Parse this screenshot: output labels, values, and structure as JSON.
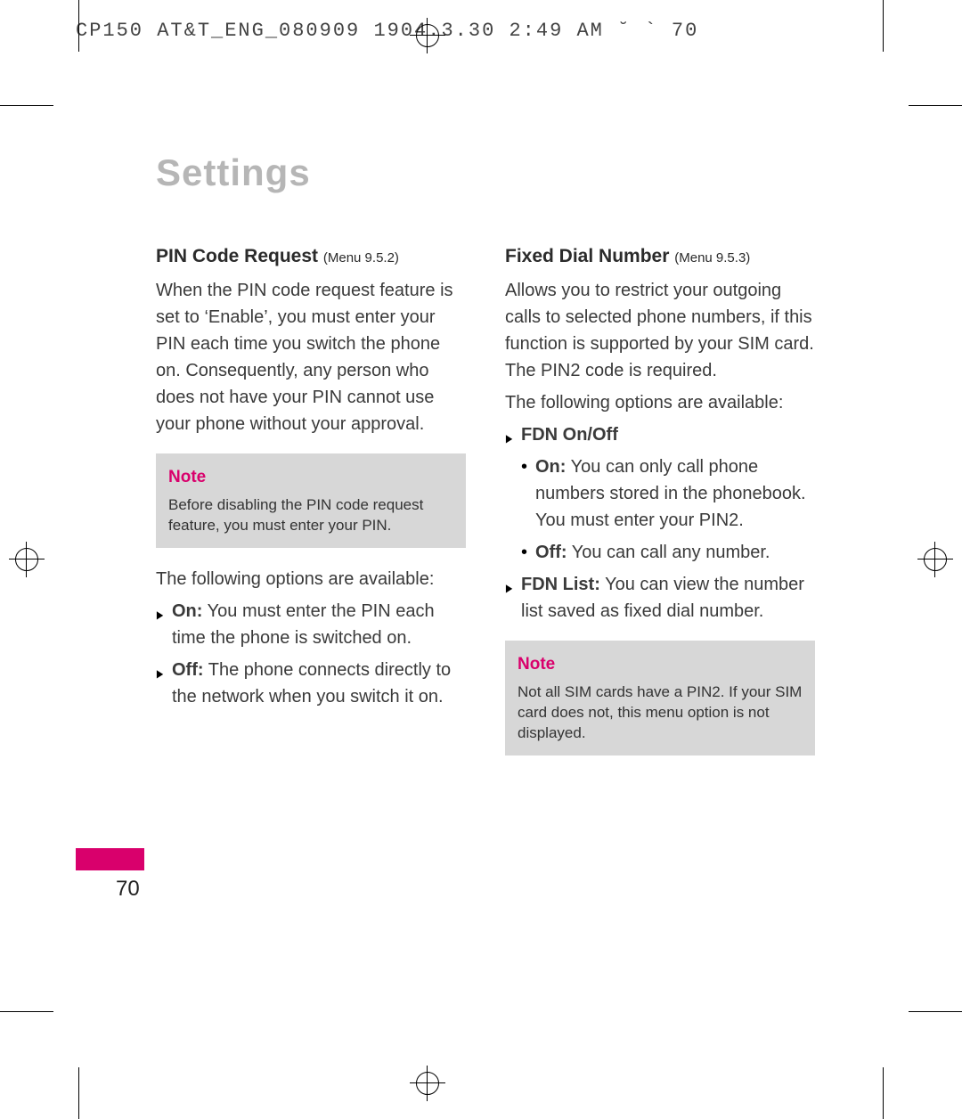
{
  "header": "CP150 AT&T_ENG_080909  1904.3.30 2:49 AM  ˘  ` 70",
  "title": "Settings",
  "page_number": "70",
  "left": {
    "heading": "PIN Code Request",
    "menu": "(Menu 9.5.2)",
    "intro": "When the PIN code request feature is set to ‘Enable’, you must enter your PIN each time you switch the phone on. Consequently, any person who does not have your PIN cannot use your phone without your approval.",
    "note_title": "Note",
    "note_body": "Before disabling the PIN code request feature, you must enter your PIN.",
    "options_intro": "The following options are available:",
    "opt_on_label": "On:",
    "opt_on_text": " You must enter the PIN each time the phone is switched on.",
    "opt_off_label": "Off:",
    "opt_off_text": " The phone connects directly to the network when you switch it on."
  },
  "right": {
    "heading": "Fixed Dial Number",
    "menu": "(Menu 9.5.3)",
    "intro": "Allows you to restrict your outgoing calls to selected phone numbers, if this function is supported by your SIM card. The PIN2 code is required.",
    "options_intro": "The following options are available:",
    "fdn_label": "FDN On/Off",
    "sub_on_label": "On:",
    "sub_on_text": " You can only call phone numbers stored in the phonebook. You must enter your PIN2.",
    "sub_off_label": "Off:",
    "sub_off_text": " You can call any number.",
    "fdn_list_label": "FDN List:",
    "fdn_list_text": " You can view the number list saved as fixed dial number.",
    "note_title": "Note",
    "note_body": "Not all SIM cards have a PIN2. If your SIM card does not, this menu option is not displayed."
  }
}
